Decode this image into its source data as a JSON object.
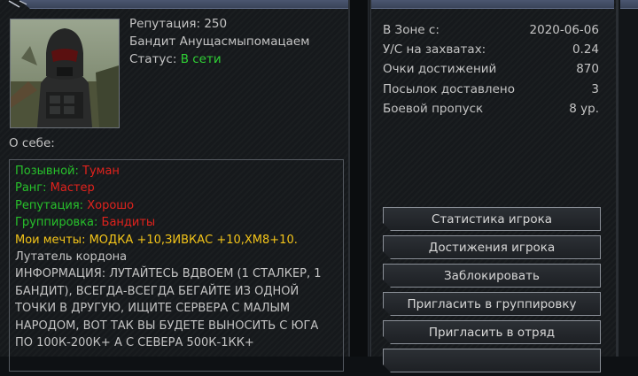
{
  "profile": {
    "reputation": "Репутация: 250",
    "name": "Бандит Анущасмыпомацаем",
    "status_label": "Статус:",
    "status_value": "В сети"
  },
  "about_label": "О себе:",
  "bio": {
    "callsign_label": "Позывной:",
    "callsign_value": "Туман",
    "rank_label": "Ранг:",
    "rank_value": "Мастер",
    "reputation_label": "Репутация:",
    "reputation_value": "Хорошо",
    "faction_label": "Группировка:",
    "faction_value": "Бандиты",
    "dreams": "Мои мечты: МОДКА +10,ЗИВКАС +10,ХМ8+10.",
    "line_looter": "Лутатель кордона",
    "info": "ИНФОРМАЦИЯ: ЛУТАЙТЕСЬ ВДВОЕМ (1 СТАЛКЕР, 1 БАНДИТ), ВСЕГДА-ВСЕГДА БЕГАЙТЕ ИЗ ОДНОЙ ТОЧКИ В ДРУГУЮ, ИЩИТЕ СЕРВЕРА С МАЛЫМ НАРОДОМ, ВОТ ТАК ВЫ БУДЕТЕ ВЫНОСИТЬ С ЮГА ПО 100К-200К+ А С СЕВЕРА 500К-1КК+"
  },
  "stats": [
    {
      "label": "В Зоне с:",
      "value": "2020-06-06"
    },
    {
      "label": "У/С на захватах:",
      "value": "0.24"
    },
    {
      "label": "Очки достижений",
      "value": "870"
    },
    {
      "label": "Посылок доставлено",
      "value": "3"
    },
    {
      "label": "Боевой пропуск",
      "value": "8 ур."
    }
  ],
  "buttons": {
    "player_stats": "Статистика игрока",
    "achievements": "Достижения игрока",
    "block": "Заблокировать",
    "invite_faction": "Пригласить в группировку",
    "invite_squad": "Пригласить в отряд"
  },
  "colors": {
    "online": "#2fcf35",
    "label_green": "#27c12b",
    "value_red": "#e0221c",
    "dreams_yellow": "#f3c419",
    "header_bar": "#4b5670"
  },
  "icons": [
    "pin-icon"
  ]
}
